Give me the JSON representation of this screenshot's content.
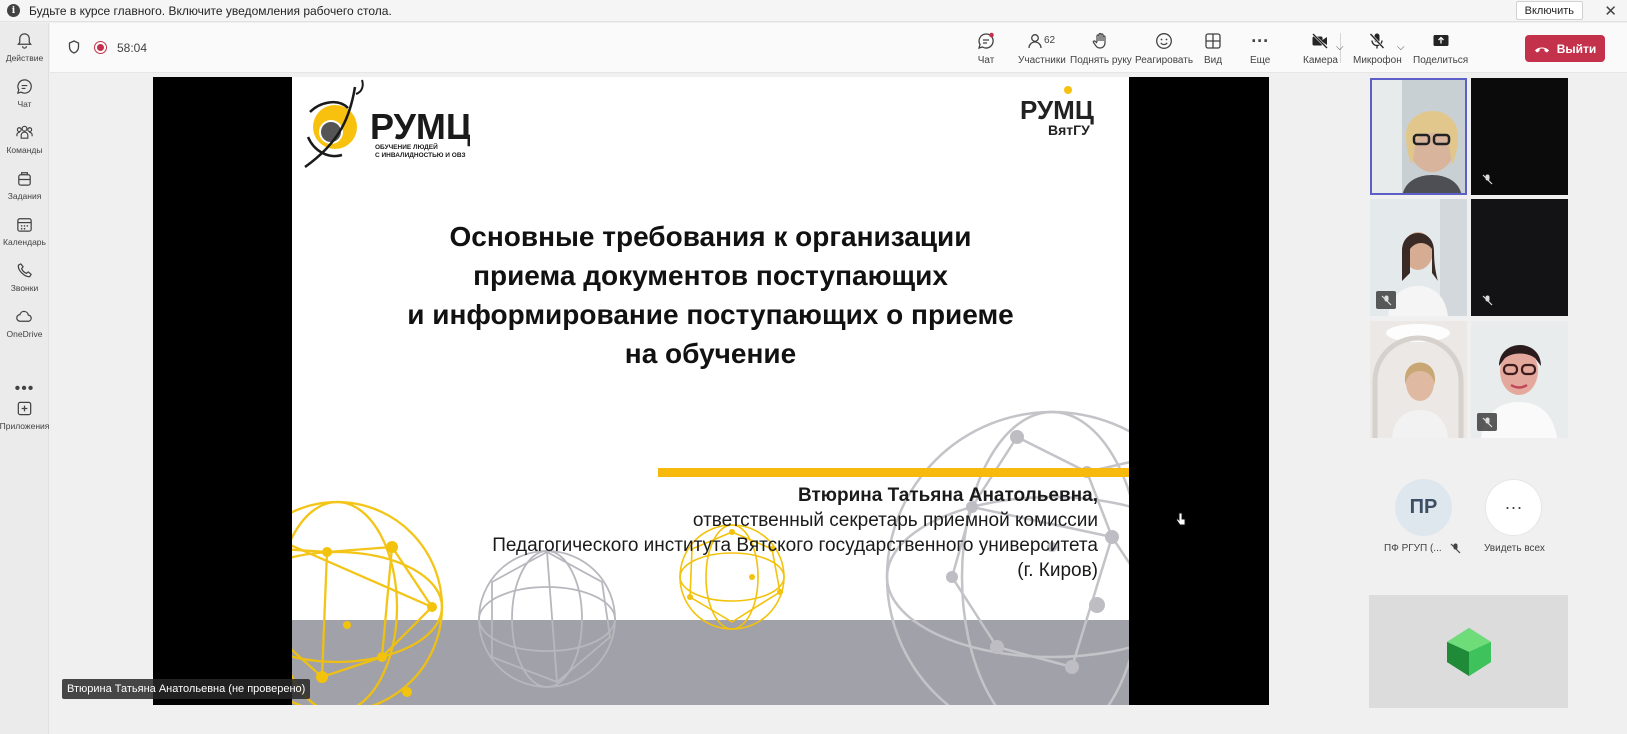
{
  "notification": {
    "message": "Будьте в курсе главного. Включите уведомления рабочего стола.",
    "enable_label": "Включить",
    "info_glyph": "i",
    "close_glyph": "✕"
  },
  "rail": {
    "items": [
      {
        "label": "Действие",
        "icon": "bell-icon"
      },
      {
        "label": "Чат",
        "icon": "chat-icon"
      },
      {
        "label": "Команды",
        "icon": "teams-icon"
      },
      {
        "label": "Задания",
        "icon": "bag-icon"
      },
      {
        "label": "Календарь",
        "icon": "calendar-icon"
      },
      {
        "label": "Звонки",
        "icon": "phone-icon"
      },
      {
        "label": "OneDrive",
        "icon": "cloud-icon"
      },
      {
        "label": "Приложения",
        "icon": "plus-square-icon"
      }
    ],
    "more_glyph": "•••"
  },
  "toolbar": {
    "timer": "58:04",
    "chat_label": "Чат",
    "participants_label": "Участники",
    "participants_count": "62",
    "raise_hand_label": "Поднять руку",
    "react_label": "Реагировать",
    "view_label": "Вид",
    "more_label": "Еще",
    "camera_label": "Камера",
    "mic_label": "Микрофон",
    "share_label": "Поделиться",
    "leave_label": "Выйти",
    "chevron_glyph": "⌵",
    "more_glyph": "···"
  },
  "slide": {
    "logo_text": "РУМЦ",
    "logo_subtitle_1": "ОБУЧЕНИЕ ЛЮДЕЙ",
    "logo_subtitle_2": "С ИНВАЛИДНОСТЬЮ И ОВЗ",
    "logo2_text": "РУМЦ",
    "logo2_sub": "ВятГУ",
    "title_lines": [
      "Основные требования к организации",
      "приема документов поступающих",
      "и информирование поступающих о приеме",
      "на обучение"
    ],
    "author_name": "Втюрина Татьяна Анатольевна,",
    "author_lines": [
      "ответственный секретарь приемной комиссии",
      "Педагогического института Вятского государственного университета",
      "(г. Киров)"
    ]
  },
  "presenter_tag": "Втюрина Татьяна Анатольевна (не проверено)",
  "participants": {
    "avatar_initials": "ПР",
    "avatar_name": "ПФ РГУП (...",
    "see_all_label": "Увидеть всех",
    "see_all_glyph": "···"
  },
  "colors": {
    "leave": "#c4314b",
    "accent_yellow": "#f7b90b",
    "selected_tile": "#5b5fc7"
  }
}
